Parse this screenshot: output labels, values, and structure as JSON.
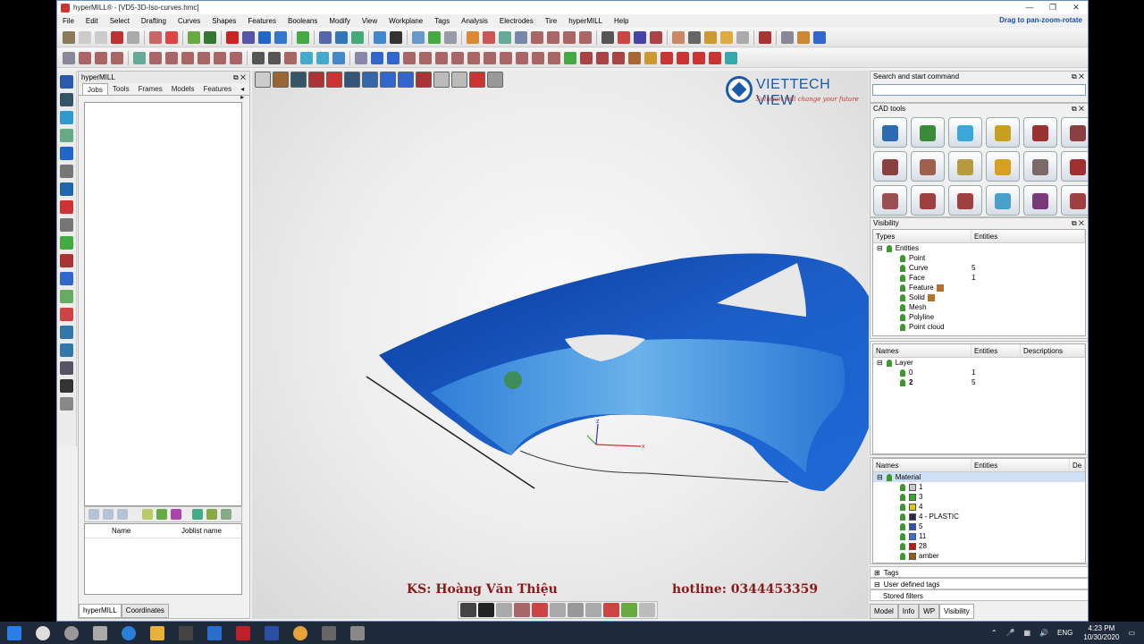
{
  "window": {
    "title": "hyperMILL® - [VD5-3D-Iso-curves.hmc]"
  },
  "menu": {
    "items": [
      "File",
      "Edit",
      "Select",
      "Drafting",
      "Curves",
      "Shapes",
      "Features",
      "Booleans",
      "Modify",
      "View",
      "Workplane",
      "Tags",
      "Analysis",
      "Electrodes",
      "Tire",
      "hyperMILL",
      "Help"
    ],
    "hint": "Drag to pan-zoom-rotate"
  },
  "browser": {
    "title": "hyperMILL",
    "tabs": [
      "Jobs",
      "Tools",
      "Frames",
      "Models",
      "Features"
    ],
    "joblist_cols": [
      "Name",
      "Joblist name"
    ],
    "bottom_tabs": [
      "hyperMILL",
      "Coordinates"
    ]
  },
  "viewport": {
    "logo_name": "VIETTECH VIEW",
    "logo_tag": "Solution will change your future",
    "footer_left": "KS: Hoàng Văn Thiệu",
    "footer_right": "hotline: 0344453359"
  },
  "right": {
    "search_title": "Search and start command",
    "cad_title": "CAD tools",
    "visibility_title": "Visibility",
    "types_cols": [
      "Types",
      "Entities"
    ],
    "types_rows": [
      {
        "name": "Entities",
        "count": ""
      },
      {
        "name": "Point",
        "count": ""
      },
      {
        "name": "Curve",
        "count": "5"
      },
      {
        "name": "Face",
        "count": "1"
      },
      {
        "name": "Feature",
        "count": ""
      },
      {
        "name": "Solid",
        "count": ""
      },
      {
        "name": "Mesh",
        "count": ""
      },
      {
        "name": "Polyline",
        "count": ""
      },
      {
        "name": "Point cloud",
        "count": ""
      }
    ],
    "layer_cols": [
      "Names",
      "Entities",
      "Descriptions"
    ],
    "layer_rows": [
      {
        "name": "Layer",
        "count": ""
      },
      {
        "name": "0",
        "count": "1"
      },
      {
        "name": "2",
        "count": "5"
      }
    ],
    "material_cols": [
      "Names",
      "Entities",
      "De"
    ],
    "material_rows": [
      {
        "name": "Material",
        "color": ""
      },
      {
        "name": "1",
        "color": "#c8c8c8"
      },
      {
        "name": "3",
        "color": "#3aa82e"
      },
      {
        "name": "4",
        "color": "#d8c81a"
      },
      {
        "name": "4 - PLASTIC",
        "color": "#2a2a40"
      },
      {
        "name": "5",
        "color": "#2c4fc4"
      },
      {
        "name": "11",
        "color": "#3b6fd0"
      },
      {
        "name": "28",
        "color": "#c01818"
      },
      {
        "name": "amber",
        "color": "#9a5a1a"
      }
    ],
    "tags": "Tags",
    "user_tags": "User defined tags",
    "stored_filters": "Stored filters",
    "bottom_tabs": [
      "Model",
      "Info",
      "WP",
      "Visibility"
    ]
  },
  "taskbar": {
    "lang": "ENG",
    "time": "4:23 PM",
    "date": "10/30/2020"
  }
}
